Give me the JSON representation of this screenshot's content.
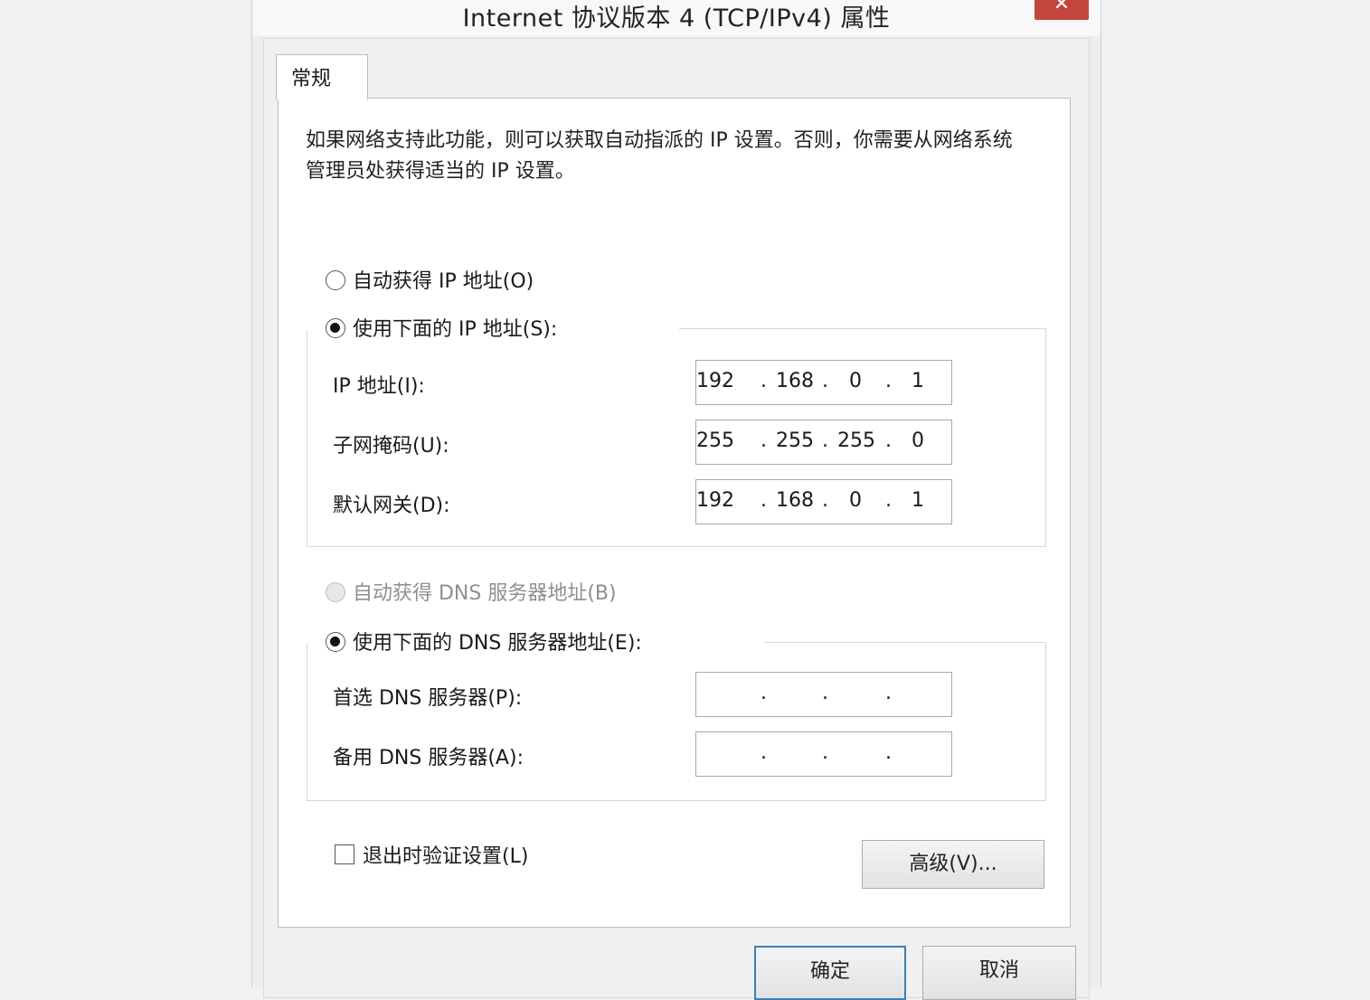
{
  "window": {
    "title": "Internet 协议版本 4 (TCP/IPv4) 属性",
    "close_glyph": "✕"
  },
  "tabs": [
    {
      "label": "常规",
      "active": true
    }
  ],
  "description": "如果网络支持此功能，则可以获取自动指派的 IP 设置。否则，你需要从网络系统管理员处获得适当的 IP 设置。",
  "ip_section": {
    "auto_option": {
      "label": "自动获得 IP 地址(O)",
      "checked": false
    },
    "manual_option": {
      "label": "使用下面的 IP 地址(S):",
      "checked": true
    },
    "fields": [
      {
        "label": "IP 地址(I):",
        "octets": [
          "192",
          "168",
          "0",
          "1"
        ]
      },
      {
        "label": "子网掩码(U):",
        "octets": [
          "255",
          "255",
          "255",
          "0"
        ]
      },
      {
        "label": "默认网关(D):",
        "octets": [
          "192",
          "168",
          "0",
          "1"
        ]
      }
    ]
  },
  "dns_section": {
    "auto_option": {
      "label": "自动获得 DNS 服务器地址(B)",
      "checked": false,
      "disabled": true
    },
    "manual_option": {
      "label": "使用下面的 DNS 服务器地址(E):",
      "checked": true
    },
    "fields": [
      {
        "label": "首选 DNS 服务器(P):",
        "octets": [
          "",
          "",
          "",
          ""
        ]
      },
      {
        "label": "备用 DNS 服务器(A):",
        "octets": [
          "",
          "",
          "",
          ""
        ]
      }
    ]
  },
  "validate_checkbox": {
    "label": "退出时验证设置(L)",
    "checked": false
  },
  "advanced_button": "高级(V)...",
  "ok_button": "确定",
  "cancel_button": "取消",
  "ip_separator": "."
}
